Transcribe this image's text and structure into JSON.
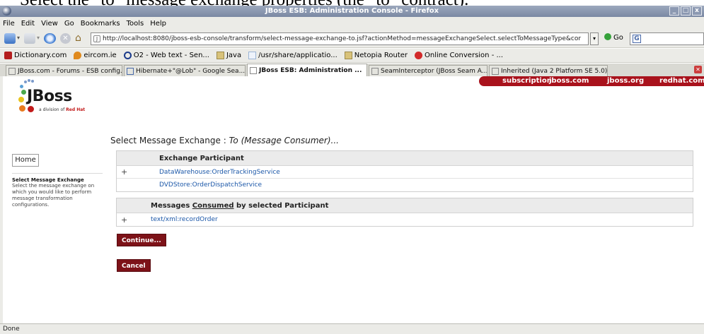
{
  "caption": "Select the \"to\" message exchange properties (the \"to\" contract).",
  "window": {
    "title": "JBoss ESB: Administration Console - Firefox",
    "buttons": [
      "_",
      "□",
      "x"
    ]
  },
  "menu": [
    "File",
    "Edit",
    "View",
    "Go",
    "Bookmarks",
    "Tools",
    "Help"
  ],
  "nav": {
    "url": "http://localhost:8080/jboss-esb-console/transform/select-message-exchange-to.jsf?actionMethod=messageExchangeSelect.selectToMessageType&cor",
    "go_label": "Go"
  },
  "bookmarks": [
    {
      "label": "Dictionary.com",
      "icon": "dictionary-icon",
      "color": "#b41e1e"
    },
    {
      "label": "eircom.ie",
      "icon": "eircom-icon",
      "color": "#e08a1e"
    },
    {
      "label": "O2 - Web text - Sen...",
      "icon": "o2-icon",
      "color": "#1a3a8a"
    },
    {
      "label": "Java",
      "icon": "folder-icon",
      "color": "#d8c27a"
    },
    {
      "label": "/usr/share/applicatio...",
      "icon": "page-icon",
      "color": "#9bb5d6"
    },
    {
      "label": "Netopia Router",
      "icon": "folder-icon",
      "color": "#d8c27a"
    },
    {
      "label": "Online Conversion - ...",
      "icon": "conversion-icon",
      "color": "#d22a2a"
    }
  ],
  "tabs": [
    {
      "label": "JBoss.com - Forums - ESB config...",
      "active": false
    },
    {
      "label": "Hibernate+\"@Lob\" - Google Sea...",
      "active": false
    },
    {
      "label": "JBoss ESB: Administration ...",
      "active": true
    },
    {
      "label": "SeamInterceptor (JBoss Seam A...",
      "active": false
    },
    {
      "label": "Inherited (Java 2 Platform SE 5.0)",
      "active": false
    }
  ],
  "top_links": [
    "subscription",
    "jboss.com",
    "jboss.org",
    "redhat.com"
  ],
  "logo": {
    "word": "JBoss",
    "tagline_prefix": "a division of ",
    "tagline_brand": "Red Hat"
  },
  "page": {
    "heading_prefix": "Select Message Exchange : ",
    "heading_italic": "To (Message Consumer)..."
  },
  "sidebar": {
    "home_label": "Home",
    "section_title": "Select Message Exchange",
    "section_desc": "Select the message exchange on which you would like to perform message transformation configurations."
  },
  "participants_table": {
    "header": "Exchange Participant",
    "rows": [
      {
        "marker": "+",
        "value": "DataWarehouse:OrderTrackingService"
      },
      {
        "marker": "",
        "value": "DVDStore:OrderDispatchService"
      }
    ]
  },
  "messages_table": {
    "header_before": "Messages ",
    "header_underlined": "Consumed",
    "header_after": " by selected Participant",
    "rows": [
      {
        "marker": "+",
        "value": "text/xml:recordOrder"
      }
    ]
  },
  "buttons": {
    "continue": "Continue...",
    "cancel": "Cancel"
  },
  "status": "Done",
  "colors": {
    "brand_red": "#a9121c",
    "button_dark_red": "#7d1218",
    "link_blue": "#1b57a8"
  }
}
